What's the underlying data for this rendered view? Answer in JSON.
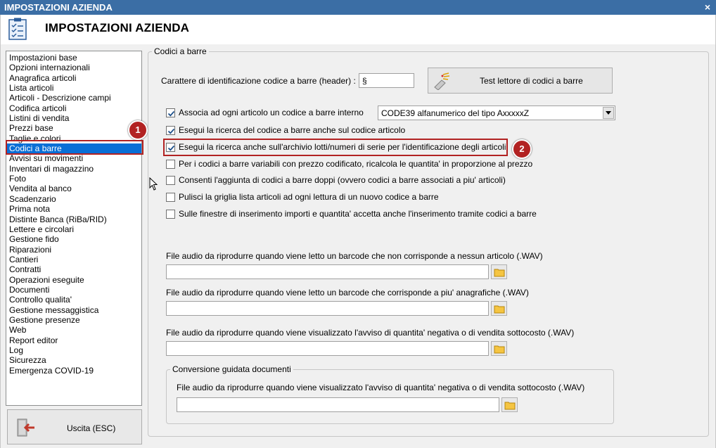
{
  "window": {
    "titlebar": "IMPOSTAZIONI AZIENDA",
    "close_glyph": "×",
    "header_title": "IMPOSTAZIONI AZIENDA"
  },
  "sidebar": {
    "items": [
      "Impostazioni base",
      "Opzioni internazionali",
      "Anagrafica articoli",
      "Lista articoli",
      "Articoli - Descrizione campi",
      "Codifica articoli",
      "Listini di vendita",
      "Prezzi base",
      "Taglie e colori",
      "Codici a barre",
      "Avvisi su movimenti",
      "Inventari di magazzino",
      "Foto",
      "Vendita al banco",
      "Scadenzario",
      "Prima nota",
      "Distinte Banca (RiBa/RID)",
      "Lettere e circolari",
      "Gestione fido",
      "Riparazioni",
      "Cantieri",
      "Contratti",
      "Operazioni eseguite",
      "Documenti",
      "Controllo qualita'",
      "Gestione messaggistica",
      "Gestione presenze",
      "Web",
      "Report editor",
      "Log",
      "Sicurezza",
      "Emergenza COVID-19"
    ],
    "selected_index": 9,
    "exit_label": "Uscita (ESC)"
  },
  "markers": {
    "one": "1",
    "two": "2"
  },
  "colors": {
    "accent": "#0a6fd6",
    "highlight": "#b22222",
    "titlebar": "#3b6ea5"
  },
  "barcode": {
    "group_title": "Codici a barre",
    "header_char_label": "Carattere di identificazione codice a barre (header) :",
    "header_char_value": "§",
    "test_button_label": "Test lettore di codici a barre",
    "options": [
      {
        "label": "Associa ad ogni articolo un codice a barre interno",
        "checked": true
      },
      {
        "label": "Esegui la ricerca del codice a barre anche sul codice articolo",
        "checked": true
      },
      {
        "label": "Esegui la ricerca anche sull'archivio lotti/numeri di serie per l'identificazione degli articoli",
        "checked": true
      },
      {
        "label": "Per i codici a barre variabili con prezzo codificato, ricalcola le quantita' in proporzione al prezzo",
        "checked": false
      },
      {
        "label": "Consenti l'aggiunta di codici a barre doppi (ovvero codici a barre associati a piu' articoli)",
        "checked": false
      },
      {
        "label": "Pulisci la griglia lista articoli ad ogni lettura di un nuovo codice a barre",
        "checked": false
      },
      {
        "label": "Sulle finestre di inserimento importi e quantita' accetta anche l'inserimento tramite codici a barre",
        "checked": false
      }
    ],
    "code_type_value": "CODE39 alfanumerico del tipo AxxxxxZ",
    "audio": [
      {
        "label": "File audio da riprodurre quando viene letto un barcode che non corrisponde a nessun articolo (.WAV)",
        "value": ""
      },
      {
        "label": "File audio da riprodurre quando viene letto un barcode che corrisponde a piu' anagrafiche (.WAV)",
        "value": ""
      },
      {
        "label": "File audio da riprodurre quando viene visualizzato l'avviso di quantita' negativa o di vendita sottocosto (.WAV)",
        "value": ""
      }
    ],
    "conversion": {
      "group_title": "Conversione guidata documenti",
      "label": "File audio da riprodurre quando viene visualizzato l'avviso di quantita' negativa o di vendita sottocosto (.WAV)",
      "value": ""
    }
  }
}
